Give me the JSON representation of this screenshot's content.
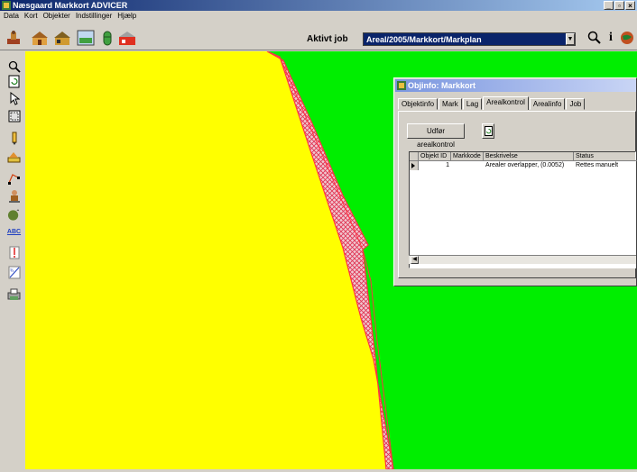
{
  "window": {
    "title": "Næsgaard Markkort ADVICER",
    "controls": {
      "minimize": "_",
      "maximize": "▫",
      "close": "×"
    }
  },
  "menu": [
    "Data",
    "Kort",
    "Objekter",
    "Indstillinger",
    "Hjælp"
  ],
  "toolbar": {
    "icons": [
      "farmer-icon",
      "barn-icon",
      "barn-icon",
      "abc-map-icon",
      "silo-icon",
      "farm-building-icon"
    ],
    "job_label": "Aktivt job",
    "job_value": "Areal/2005/Markkort/Markplan",
    "right_icons": [
      "zoom-icon",
      "info-icon",
      "globe-icon"
    ],
    "info_glyph": "i"
  },
  "sidebar": {
    "tools": [
      "zoom-tool-icon",
      "refresh-tool-icon",
      "pointer-tool-icon",
      "select-tool-icon",
      "pencil-tool-icon",
      "measure-tool-icon",
      "node-tool-icon",
      "person-tool-icon",
      "add-object-tool-icon",
      "label-tool-icon",
      "pin-tool-icon",
      "split-tool-icon",
      "print-tool-icon"
    ],
    "label_tool_text": "ABC"
  },
  "map": {
    "field_color": "#ffff00",
    "background_color": "#00ee00",
    "overlap_color": "#ff3344"
  },
  "dialog": {
    "title": "Objinfo: Markkort",
    "tabs": [
      "Objektinfo",
      "Mark",
      "Lag",
      "Arealkontrol",
      "Arealinfo",
      "Job"
    ],
    "active_tab": 3,
    "run_button": "Udfør arealkontrol",
    "columns": [
      "Objekt ID",
      "Markkode",
      "Beskrivelse",
      "Status"
    ],
    "rows": [
      {
        "id": "1",
        "markkode": "",
        "beskrivelse": "Arealer overlapper, (0.0052)",
        "status": "Rettes manuelt"
      }
    ]
  }
}
